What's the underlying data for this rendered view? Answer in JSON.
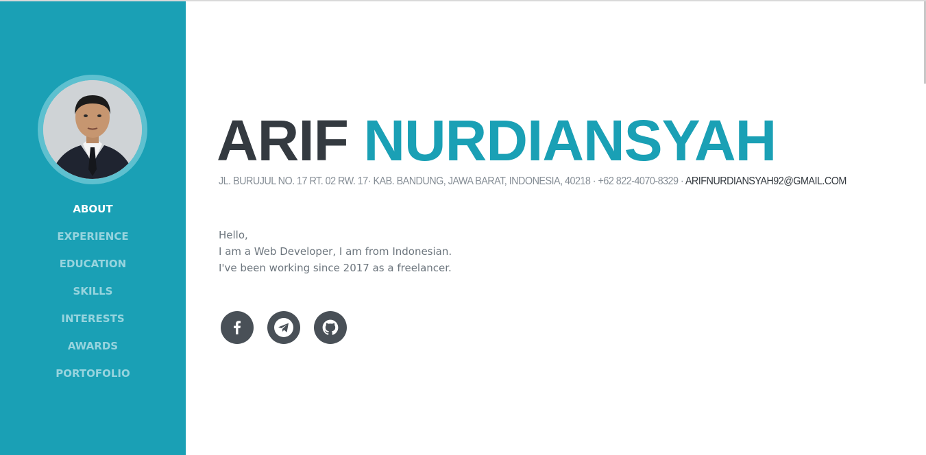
{
  "profile": {
    "first_name": "ARIF",
    "last_name": "NURDIANSYAH",
    "address_line": "JL. BURUJUL NO. 17 RT. 02 RW. 17· KAB. BANDUNG, JAWA BARAT, INDONESIA, 40218 · +62 822-4070-8329 ·",
    "email": "ARIFNURDIANSYAH92@GMAIL.COM",
    "intro": [
      "Hello,",
      "I am a Web Developer, I am from Indonesian.",
      "I've been working since 2017 as a freelancer."
    ]
  },
  "nav": {
    "items": [
      {
        "label": "ABOUT",
        "active": true
      },
      {
        "label": "EXPERIENCE",
        "active": false
      },
      {
        "label": "EDUCATION",
        "active": false
      },
      {
        "label": "SKILLS",
        "active": false
      },
      {
        "label": "INTERESTS",
        "active": false
      },
      {
        "label": "AWARDS",
        "active": false
      },
      {
        "label": "PORTOFOLIO",
        "active": false
      }
    ]
  },
  "socials": [
    {
      "icon": "facebook-icon"
    },
    {
      "icon": "telegram-icon"
    },
    {
      "icon": "github-icon"
    }
  ],
  "colors": {
    "primary": "#1aa0b5",
    "dark": "#343a40",
    "muted": "#868e96",
    "social_bg": "#495057"
  }
}
